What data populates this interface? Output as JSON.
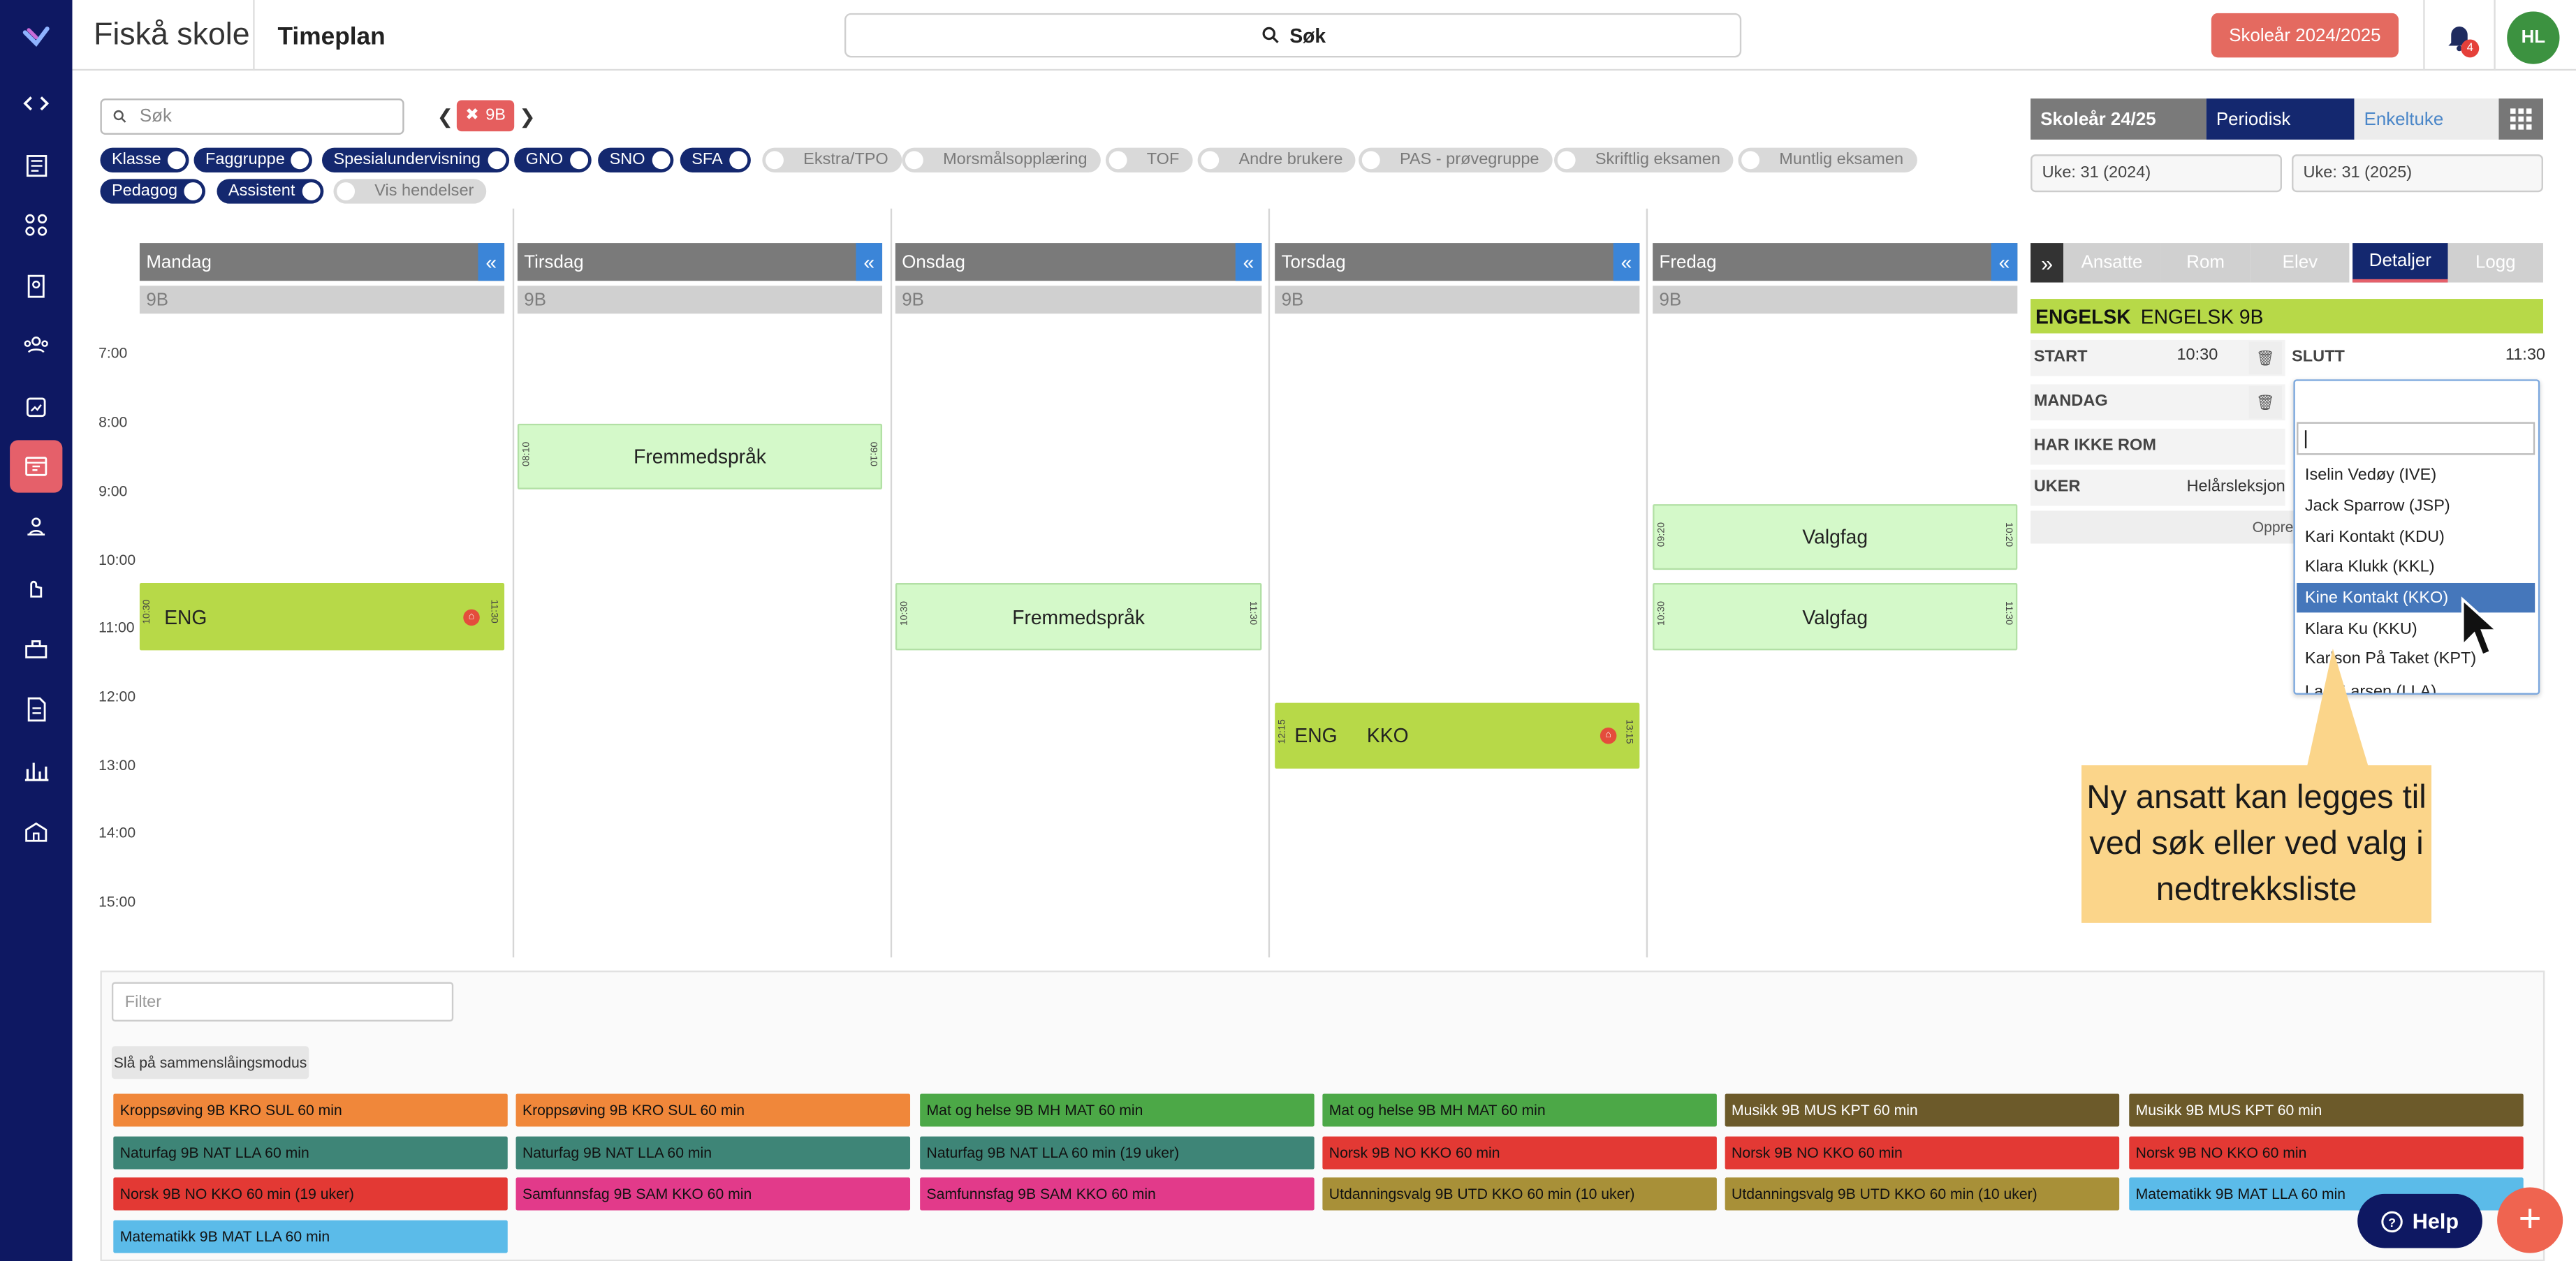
{
  "header": {
    "school": "Fiskå skole",
    "module": "Timeplan",
    "search_label": "Søk",
    "school_year_button": "Skoleår 2024/2025",
    "notification_count": "4",
    "avatar_initials": "HL"
  },
  "filters": {
    "search_placeholder": "Søk",
    "class_chip": "9B",
    "chips_on": [
      "Klasse",
      "Faggruppe",
      "Spesialundervisning",
      "GNO",
      "SNO",
      "SFA",
      "Pedagog",
      "Assistent"
    ],
    "chips_off": [
      "Ekstra/TPO",
      "Morsmålsopplæring",
      "TOF",
      "Andre brukere",
      "PAS - prøvegruppe",
      "Skriftlig eksamen",
      "Muntlig eksamen",
      "Vis hendelser"
    ]
  },
  "calendar": {
    "hours": [
      "7:00",
      "8:00",
      "9:00",
      "10:00",
      "11:00",
      "12:00",
      "13:00",
      "14:00",
      "15:00"
    ],
    "days": [
      "Mandag",
      "Tirsdag",
      "Onsdag",
      "Torsdag",
      "Fredag"
    ],
    "day_class": "9B",
    "collapse_icon": "«",
    "events": [
      {
        "title": "ENG",
        "start": "10:30",
        "end": "11:30",
        "teacher": ""
      },
      {
        "title": "Fremmedspråk",
        "start": "08:10",
        "end": "09:10"
      },
      {
        "title": "Fremmedspråk",
        "start": "10:30",
        "end": "11:30"
      },
      {
        "title": "ENG",
        "teacher": "KKO",
        "start": "12:15",
        "end": "13:15"
      },
      {
        "title": "Valgfag",
        "start": "09:20",
        "end": "10:20"
      },
      {
        "title": "Valgfag",
        "start": "10:30",
        "end": "11:30"
      }
    ]
  },
  "right_panel": {
    "year_tab": "Skoleår 24/25",
    "periodic_tab": "Periodisk",
    "single_week_tab": "Enkeltuke",
    "week_from": "Uke: 31 (2024)",
    "week_to": "Uke: 31 (2025)",
    "expand_icon": "»",
    "detail_tabs": [
      "Ansatte",
      "Rom",
      "Elev",
      "Detaljer",
      "Logg"
    ],
    "subject_code": "ENGELSK",
    "subject_name": "ENGELSK 9B",
    "start_label": "START",
    "start_value": "10:30",
    "end_label": "SLUTT",
    "end_value": "11:30",
    "day_label": "MANDAG",
    "room_label": "HAR IKKE ROM",
    "weeks_label": "UKER",
    "weeks_value": "Helårsleksjon",
    "create_button_partial": "Oppre",
    "dropdown_items": [
      "Iselin Vedøy (IVE)",
      "Jack Sparrow (JSP)",
      "Kari Kontakt (KDU)",
      "Klara Klukk (KKL)",
      "Kine Kontakt (KKO)",
      "Klara Ku (KKU)",
      "Karlson På Taket (KPT)",
      "Lars Larsen (LLA)"
    ],
    "dropdown_selected": "Kine Kontakt (KKO)"
  },
  "callout": "Ny ansatt kan legges til ved søk eller ved valg i nedtrekksliste",
  "bottom": {
    "filter_placeholder": "Filter",
    "merge_button": "Slå på sammenslåingsmodus",
    "lessons": [
      {
        "label": "Kroppsøving 9B KRO SUL 60 min",
        "color": "#f0873a"
      },
      {
        "label": "Kroppsøving 9B KRO SUL 60 min",
        "color": "#f0873a"
      },
      {
        "label": "Mat og helse 9B MH MAT 60 min",
        "color": "#4ca847"
      },
      {
        "label": "Mat og helse 9B MH MAT 60 min",
        "color": "#4ca847"
      },
      {
        "label": "Musikk 9B MUS KPT 60 min",
        "color": "#6c5a2a"
      },
      {
        "label": "Musikk 9B MUS KPT 60 min",
        "color": "#6c5a2a"
      },
      {
        "label": "Naturfag 9B NAT LLA 60 min",
        "color": "#3e8577"
      },
      {
        "label": "Naturfag 9B NAT LLA 60 min",
        "color": "#3e8577"
      },
      {
        "label": "Naturfag 9B NAT LLA 60 min (19 uker)",
        "color": "#3e8577"
      },
      {
        "label": "Norsk 9B NO KKO 60 min",
        "color": "#e33934"
      },
      {
        "label": "Norsk 9B NO KKO 60 min",
        "color": "#e33934"
      },
      {
        "label": "Norsk 9B NO KKO 60 min",
        "color": "#e33934"
      },
      {
        "label": "Norsk 9B NO KKO 60 min (19 uker)",
        "color": "#e33934"
      },
      {
        "label": "Samfunnsfag 9B SAM KKO 60 min",
        "color": "#e23a8a"
      },
      {
        "label": "Samfunnsfag 9B SAM KKO 60 min",
        "color": "#e23a8a"
      },
      {
        "label": "Utdanningsvalg 9B UTD KKO 60 min (10 uker)",
        "color": "#a89038"
      },
      {
        "label": "Utdanningsvalg 9B UTD KKO 60 min (10 uker)",
        "color": "#a89038"
      },
      {
        "label": "Matematikk 9B MAT LLA 60 min",
        "color": "#5bbbe9"
      },
      {
        "label": "Matematikk 9B MAT LLA 60 min",
        "color": "#5bbbe9"
      }
    ],
    "help_button": "Help"
  },
  "colors": {
    "sidebar": "#0e1862",
    "accent_red": "#e46a60",
    "active_blue": "#14286f",
    "event_green": "#b7d948",
    "event_light": "#d4f9c9"
  }
}
